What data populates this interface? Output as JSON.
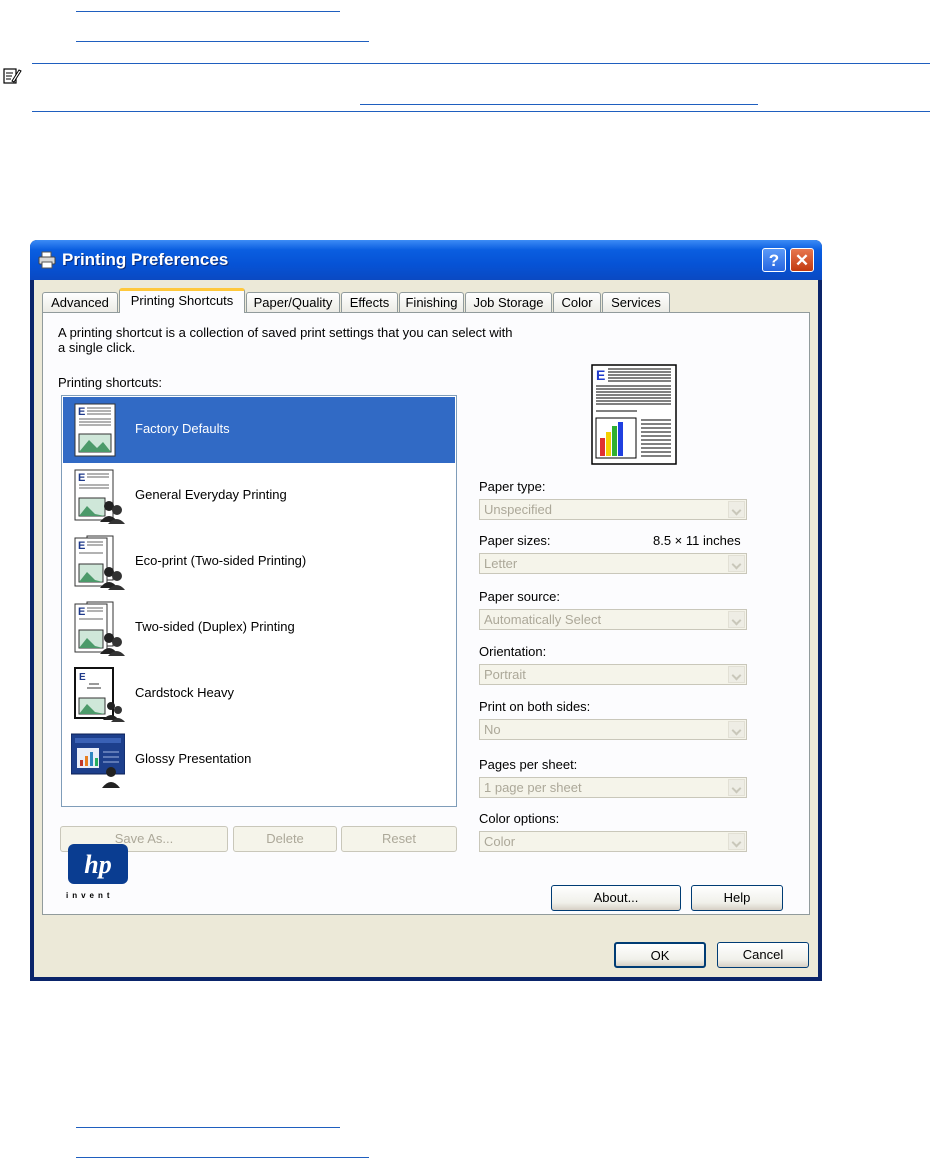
{
  "window": {
    "title": "Printing Preferences",
    "help_btn": "?",
    "close_btn": "✕"
  },
  "tabs": [
    {
      "label": "Advanced"
    },
    {
      "label": "Printing Shortcuts"
    },
    {
      "label": "Paper/Quality"
    },
    {
      "label": "Effects"
    },
    {
      "label": "Finishing"
    },
    {
      "label": "Job Storage"
    },
    {
      "label": "Color"
    },
    {
      "label": "Services"
    }
  ],
  "panel": {
    "intro": "A printing shortcut is a collection of saved print settings that you can select with a single click.",
    "shortcuts_label": "Printing shortcuts:",
    "shortcuts": [
      {
        "label": "Factory Defaults",
        "icon": "doc-landscape-icon"
      },
      {
        "label": "General Everyday Printing",
        "icon": "doc-users-icon"
      },
      {
        "label": "Eco-print (Two-sided Printing)",
        "icon": "duplex-users-icon"
      },
      {
        "label": "Two-sided (Duplex) Printing",
        "icon": "duplex-users-icon"
      },
      {
        "label": "Cardstock Heavy",
        "icon": "cardstock-users-icon"
      },
      {
        "label": "Glossy Presentation",
        "icon": "glossy-users-icon"
      }
    ],
    "selected_index": 0,
    "save_as": "Save As...",
    "delete": "Delete",
    "reset": "Reset",
    "logo_text": "invent",
    "fields": {
      "paper_type_label": "Paper type:",
      "paper_type_value": "Unspecified",
      "paper_sizes_label": "Paper sizes:",
      "paper_sizes_dim": "8.5 × 11 inches",
      "paper_sizes_value": "Letter",
      "paper_source_label": "Paper source:",
      "paper_source_value": "Automatically Select",
      "orientation_label": "Orientation:",
      "orientation_value": "Portrait",
      "both_sides_label": "Print on both sides:",
      "both_sides_value": "No",
      "pages_label": "Pages per sheet:",
      "pages_value": "1 page per sheet",
      "color_label": "Color options:",
      "color_value": "Color"
    },
    "about": "About...",
    "help": "Help"
  },
  "footer": {
    "ok": "OK",
    "cancel": "Cancel"
  },
  "colors": {
    "selection": "#316ac5",
    "link_rule": "#1f5fbf",
    "titlebar": "#0a5ee0"
  }
}
